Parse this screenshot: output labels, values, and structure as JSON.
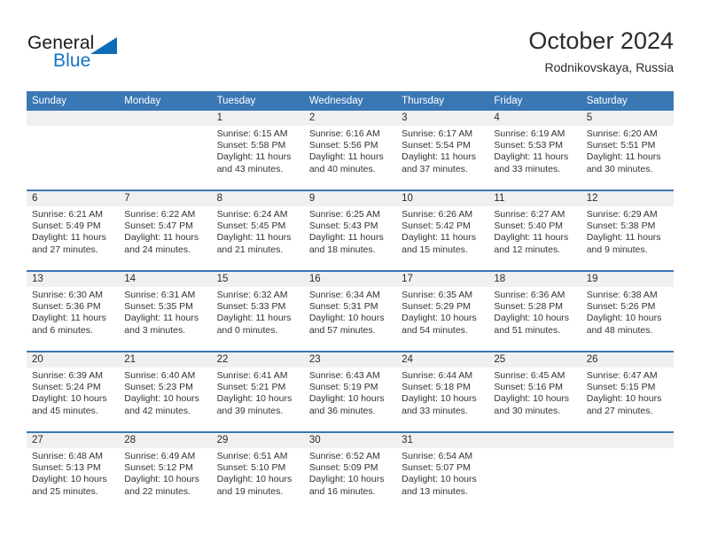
{
  "brand": {
    "name_part1": "General",
    "name_part2": "Blue",
    "triangle_color": "#0f6cb8",
    "text_color": "#1473c4"
  },
  "header": {
    "month_title": "October 2024",
    "location": "Rodnikovskaya, Russia"
  },
  "theme": {
    "header_blue": "#3a77b5",
    "daynum_band": "#f0f0f0",
    "text": "#333333"
  },
  "weekdays": [
    "Sunday",
    "Monday",
    "Tuesday",
    "Wednesday",
    "Thursday",
    "Friday",
    "Saturday"
  ],
  "weeks": [
    [
      {
        "day": "",
        "sunrise": "",
        "sunset": "",
        "daylight_line1": "",
        "daylight_line2": ""
      },
      {
        "day": "",
        "sunrise": "",
        "sunset": "",
        "daylight_line1": "",
        "daylight_line2": ""
      },
      {
        "day": "1",
        "sunrise": "Sunrise: 6:15 AM",
        "sunset": "Sunset: 5:58 PM",
        "daylight_line1": "Daylight: 11 hours",
        "daylight_line2": "and 43 minutes."
      },
      {
        "day": "2",
        "sunrise": "Sunrise: 6:16 AM",
        "sunset": "Sunset: 5:56 PM",
        "daylight_line1": "Daylight: 11 hours",
        "daylight_line2": "and 40 minutes."
      },
      {
        "day": "3",
        "sunrise": "Sunrise: 6:17 AM",
        "sunset": "Sunset: 5:54 PM",
        "daylight_line1": "Daylight: 11 hours",
        "daylight_line2": "and 37 minutes."
      },
      {
        "day": "4",
        "sunrise": "Sunrise: 6:19 AM",
        "sunset": "Sunset: 5:53 PM",
        "daylight_line1": "Daylight: 11 hours",
        "daylight_line2": "and 33 minutes."
      },
      {
        "day": "5",
        "sunrise": "Sunrise: 6:20 AM",
        "sunset": "Sunset: 5:51 PM",
        "daylight_line1": "Daylight: 11 hours",
        "daylight_line2": "and 30 minutes."
      }
    ],
    [
      {
        "day": "6",
        "sunrise": "Sunrise: 6:21 AM",
        "sunset": "Sunset: 5:49 PM",
        "daylight_line1": "Daylight: 11 hours",
        "daylight_line2": "and 27 minutes."
      },
      {
        "day": "7",
        "sunrise": "Sunrise: 6:22 AM",
        "sunset": "Sunset: 5:47 PM",
        "daylight_line1": "Daylight: 11 hours",
        "daylight_line2": "and 24 minutes."
      },
      {
        "day": "8",
        "sunrise": "Sunrise: 6:24 AM",
        "sunset": "Sunset: 5:45 PM",
        "daylight_line1": "Daylight: 11 hours",
        "daylight_line2": "and 21 minutes."
      },
      {
        "day": "9",
        "sunrise": "Sunrise: 6:25 AM",
        "sunset": "Sunset: 5:43 PM",
        "daylight_line1": "Daylight: 11 hours",
        "daylight_line2": "and 18 minutes."
      },
      {
        "day": "10",
        "sunrise": "Sunrise: 6:26 AM",
        "sunset": "Sunset: 5:42 PM",
        "daylight_line1": "Daylight: 11 hours",
        "daylight_line2": "and 15 minutes."
      },
      {
        "day": "11",
        "sunrise": "Sunrise: 6:27 AM",
        "sunset": "Sunset: 5:40 PM",
        "daylight_line1": "Daylight: 11 hours",
        "daylight_line2": "and 12 minutes."
      },
      {
        "day": "12",
        "sunrise": "Sunrise: 6:29 AM",
        "sunset": "Sunset: 5:38 PM",
        "daylight_line1": "Daylight: 11 hours",
        "daylight_line2": "and 9 minutes."
      }
    ],
    [
      {
        "day": "13",
        "sunrise": "Sunrise: 6:30 AM",
        "sunset": "Sunset: 5:36 PM",
        "daylight_line1": "Daylight: 11 hours",
        "daylight_line2": "and 6 minutes."
      },
      {
        "day": "14",
        "sunrise": "Sunrise: 6:31 AM",
        "sunset": "Sunset: 5:35 PM",
        "daylight_line1": "Daylight: 11 hours",
        "daylight_line2": "and 3 minutes."
      },
      {
        "day": "15",
        "sunrise": "Sunrise: 6:32 AM",
        "sunset": "Sunset: 5:33 PM",
        "daylight_line1": "Daylight: 11 hours",
        "daylight_line2": "and 0 minutes."
      },
      {
        "day": "16",
        "sunrise": "Sunrise: 6:34 AM",
        "sunset": "Sunset: 5:31 PM",
        "daylight_line1": "Daylight: 10 hours",
        "daylight_line2": "and 57 minutes."
      },
      {
        "day": "17",
        "sunrise": "Sunrise: 6:35 AM",
        "sunset": "Sunset: 5:29 PM",
        "daylight_line1": "Daylight: 10 hours",
        "daylight_line2": "and 54 minutes."
      },
      {
        "day": "18",
        "sunrise": "Sunrise: 6:36 AM",
        "sunset": "Sunset: 5:28 PM",
        "daylight_line1": "Daylight: 10 hours",
        "daylight_line2": "and 51 minutes."
      },
      {
        "day": "19",
        "sunrise": "Sunrise: 6:38 AM",
        "sunset": "Sunset: 5:26 PM",
        "daylight_line1": "Daylight: 10 hours",
        "daylight_line2": "and 48 minutes."
      }
    ],
    [
      {
        "day": "20",
        "sunrise": "Sunrise: 6:39 AM",
        "sunset": "Sunset: 5:24 PM",
        "daylight_line1": "Daylight: 10 hours",
        "daylight_line2": "and 45 minutes."
      },
      {
        "day": "21",
        "sunrise": "Sunrise: 6:40 AM",
        "sunset": "Sunset: 5:23 PM",
        "daylight_line1": "Daylight: 10 hours",
        "daylight_line2": "and 42 minutes."
      },
      {
        "day": "22",
        "sunrise": "Sunrise: 6:41 AM",
        "sunset": "Sunset: 5:21 PM",
        "daylight_line1": "Daylight: 10 hours",
        "daylight_line2": "and 39 minutes."
      },
      {
        "day": "23",
        "sunrise": "Sunrise: 6:43 AM",
        "sunset": "Sunset: 5:19 PM",
        "daylight_line1": "Daylight: 10 hours",
        "daylight_line2": "and 36 minutes."
      },
      {
        "day": "24",
        "sunrise": "Sunrise: 6:44 AM",
        "sunset": "Sunset: 5:18 PM",
        "daylight_line1": "Daylight: 10 hours",
        "daylight_line2": "and 33 minutes."
      },
      {
        "day": "25",
        "sunrise": "Sunrise: 6:45 AM",
        "sunset": "Sunset: 5:16 PM",
        "daylight_line1": "Daylight: 10 hours",
        "daylight_line2": "and 30 minutes."
      },
      {
        "day": "26",
        "sunrise": "Sunrise: 6:47 AM",
        "sunset": "Sunset: 5:15 PM",
        "daylight_line1": "Daylight: 10 hours",
        "daylight_line2": "and 27 minutes."
      }
    ],
    [
      {
        "day": "27",
        "sunrise": "Sunrise: 6:48 AM",
        "sunset": "Sunset: 5:13 PM",
        "daylight_line1": "Daylight: 10 hours",
        "daylight_line2": "and 25 minutes."
      },
      {
        "day": "28",
        "sunrise": "Sunrise: 6:49 AM",
        "sunset": "Sunset: 5:12 PM",
        "daylight_line1": "Daylight: 10 hours",
        "daylight_line2": "and 22 minutes."
      },
      {
        "day": "29",
        "sunrise": "Sunrise: 6:51 AM",
        "sunset": "Sunset: 5:10 PM",
        "daylight_line1": "Daylight: 10 hours",
        "daylight_line2": "and 19 minutes."
      },
      {
        "day": "30",
        "sunrise": "Sunrise: 6:52 AM",
        "sunset": "Sunset: 5:09 PM",
        "daylight_line1": "Daylight: 10 hours",
        "daylight_line2": "and 16 minutes."
      },
      {
        "day": "31",
        "sunrise": "Sunrise: 6:54 AM",
        "sunset": "Sunset: 5:07 PM",
        "daylight_line1": "Daylight: 10 hours",
        "daylight_line2": "and 13 minutes."
      },
      {
        "day": "",
        "sunrise": "",
        "sunset": "",
        "daylight_line1": "",
        "daylight_line2": ""
      },
      {
        "day": "",
        "sunrise": "",
        "sunset": "",
        "daylight_line1": "",
        "daylight_line2": ""
      }
    ]
  ]
}
